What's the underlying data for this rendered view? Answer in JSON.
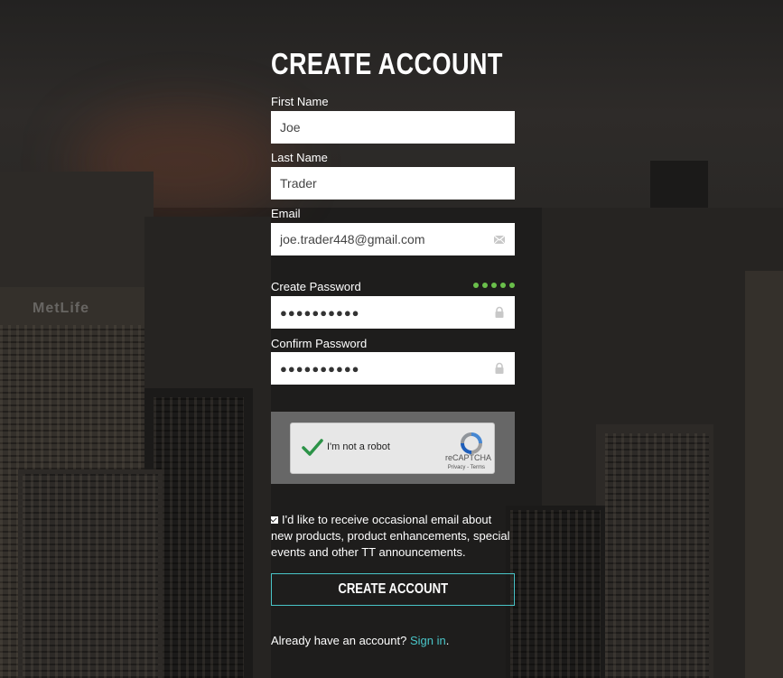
{
  "form": {
    "title": "CREATE ACCOUNT",
    "fields": {
      "first_name": {
        "label": "First Name",
        "value": "Joe"
      },
      "last_name": {
        "label": "Last Name",
        "value": "Trader"
      },
      "email": {
        "label": "Email",
        "value": "joe.trader448@gmail.com",
        "icon": "envelope-icon"
      },
      "password": {
        "label": "Create Password",
        "value": "●●●●●●●●●●",
        "icon": "lock-icon",
        "strength_dots": 5
      },
      "confirm_password": {
        "label": "Confirm Password",
        "value": "●●●●●●●●●●",
        "icon": "lock-icon"
      }
    },
    "captcha": {
      "label": "I'm not a robot",
      "brand": "reCAPTCHA",
      "terms": "Privacy - Terms",
      "checked": true
    },
    "optin": {
      "checked": true,
      "text": "I'd like to receive occasional email about new products, product enhancements, special events and other TT announcements."
    },
    "submit_label": "CREATE ACCOUNT",
    "signin": {
      "prompt": "Already have an account?",
      "link": "Sign in",
      "suffix": "."
    }
  },
  "background": {
    "sign_text": "MetLife"
  },
  "colors": {
    "accent": "#49c5c8",
    "strength": "#6abf4b",
    "captcha_panel": "#6e6e6e"
  }
}
